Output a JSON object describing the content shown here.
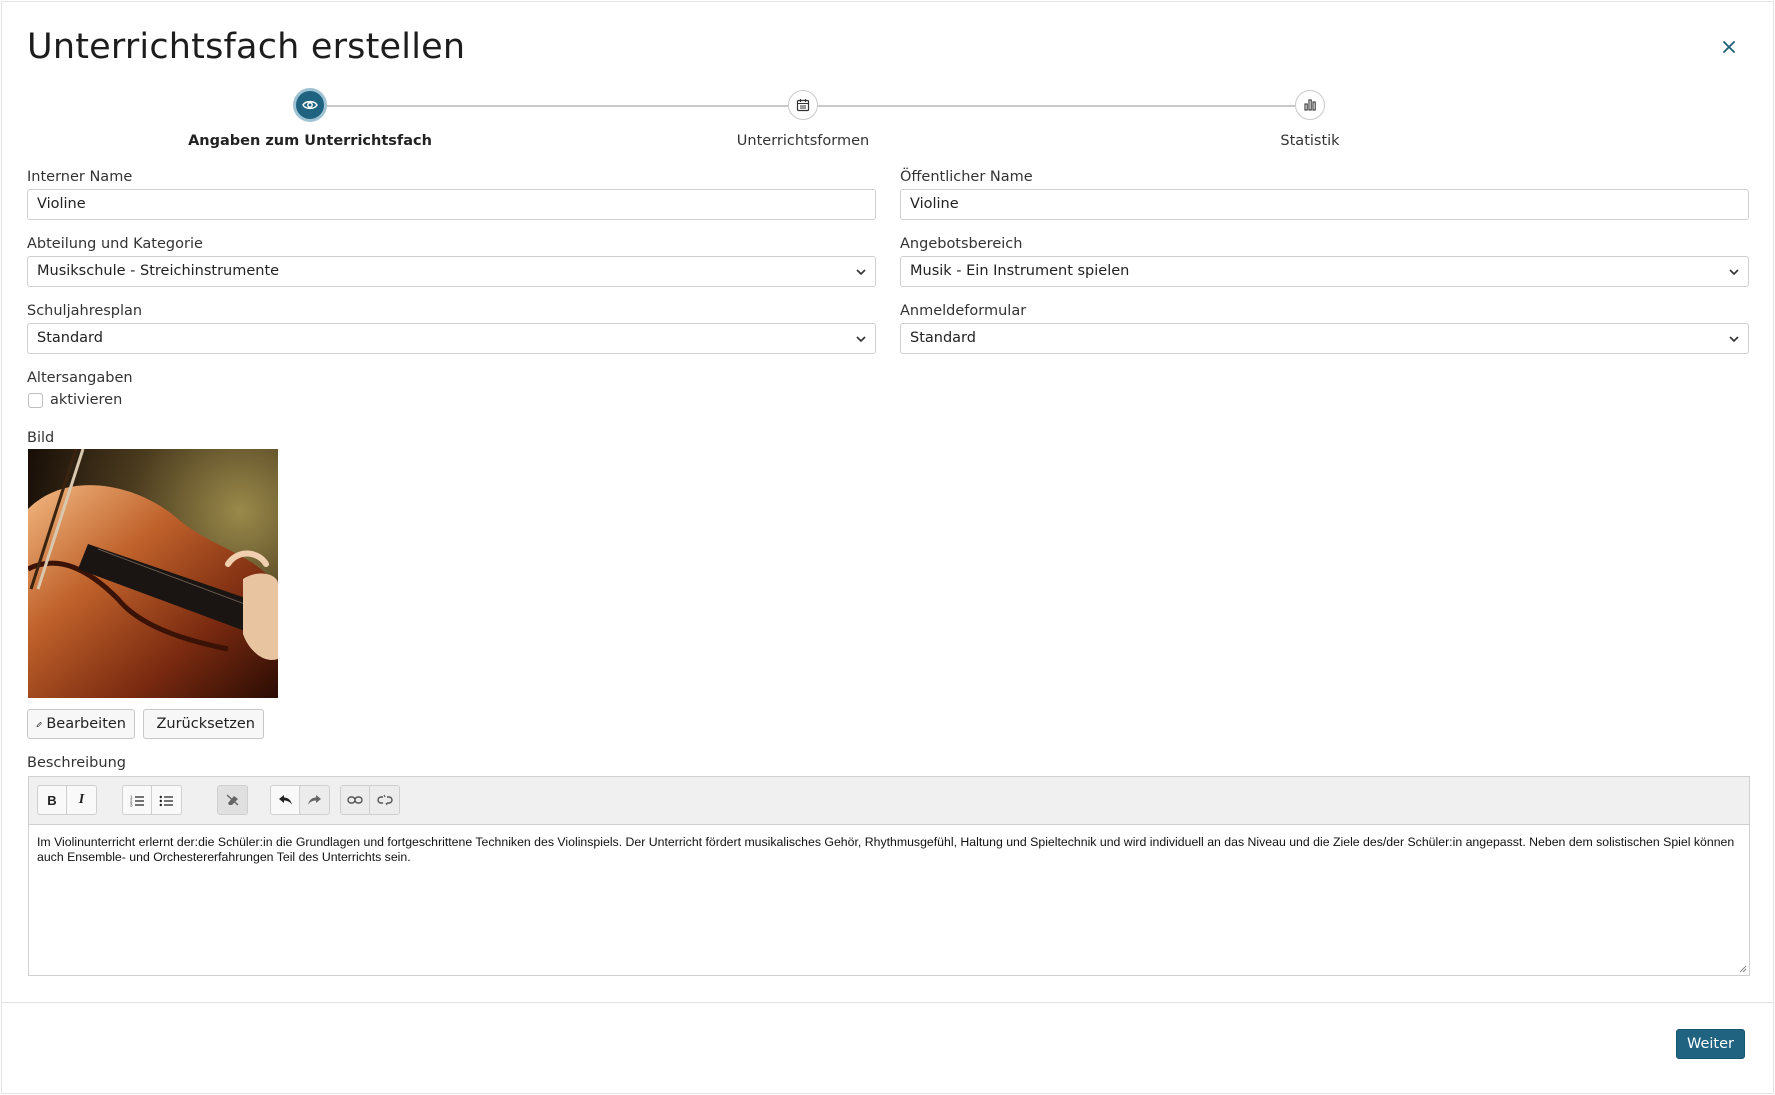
{
  "modal": {
    "title": "Unterrichtsfach erstellen",
    "close_icon": "close-icon"
  },
  "stepper": {
    "steps": [
      {
        "label": "Angaben zum Unterrichtsfach",
        "icon": "eye-icon",
        "active": true
      },
      {
        "label": "Unterrichtsformen",
        "icon": "calendar-icon",
        "active": false
      },
      {
        "label": "Statistik",
        "icon": "bar-chart-icon",
        "active": false
      }
    ]
  },
  "form": {
    "internal_name": {
      "label": "Interner Name",
      "value": "Violine"
    },
    "public_name": {
      "label": "Öffentlicher Name",
      "value": "Violine"
    },
    "department": {
      "label": "Abteilung und Kategorie",
      "value": "Musikschule - Streichinstrumente"
    },
    "offer_area": {
      "label": "Angebotsbereich",
      "value": "Musik - Ein Instrument spielen"
    },
    "school_year_plan": {
      "label": "Schuljahresplan",
      "value": "Standard"
    },
    "registration_form": {
      "label": "Anmeldeformular",
      "value": "Standard"
    },
    "age": {
      "label": "Altersangaben",
      "checkbox_label": "aktivieren",
      "checked": false
    },
    "image": {
      "label": "Bild",
      "edit_label": "Bearbeiten",
      "reset_label": "Zurücksetzen"
    },
    "description": {
      "label": "Beschreibung",
      "text": "Im Violinunterricht erlernt der:die Schüler:in die Grundlagen und fortgeschrittene Techniken des Violinspiels. Der Unterricht fördert musikalisches Gehör, Rhythmusgefühl, Haltung und Spieltechnik und wird individuell an das Niveau und die Ziele des/der Schüler:in angepasst. Neben dem solistischen Spiel können auch Ensemble- und Orchestererfahrungen Teil des Unterrichts sein.",
      "toolbar": {
        "bold": "B",
        "italic": "I"
      }
    }
  },
  "footer": {
    "next_label": "Weiter"
  },
  "colors": {
    "primary": "#1f6380",
    "active_ring": "#9fc3d3",
    "border": "#cfcfcf"
  }
}
